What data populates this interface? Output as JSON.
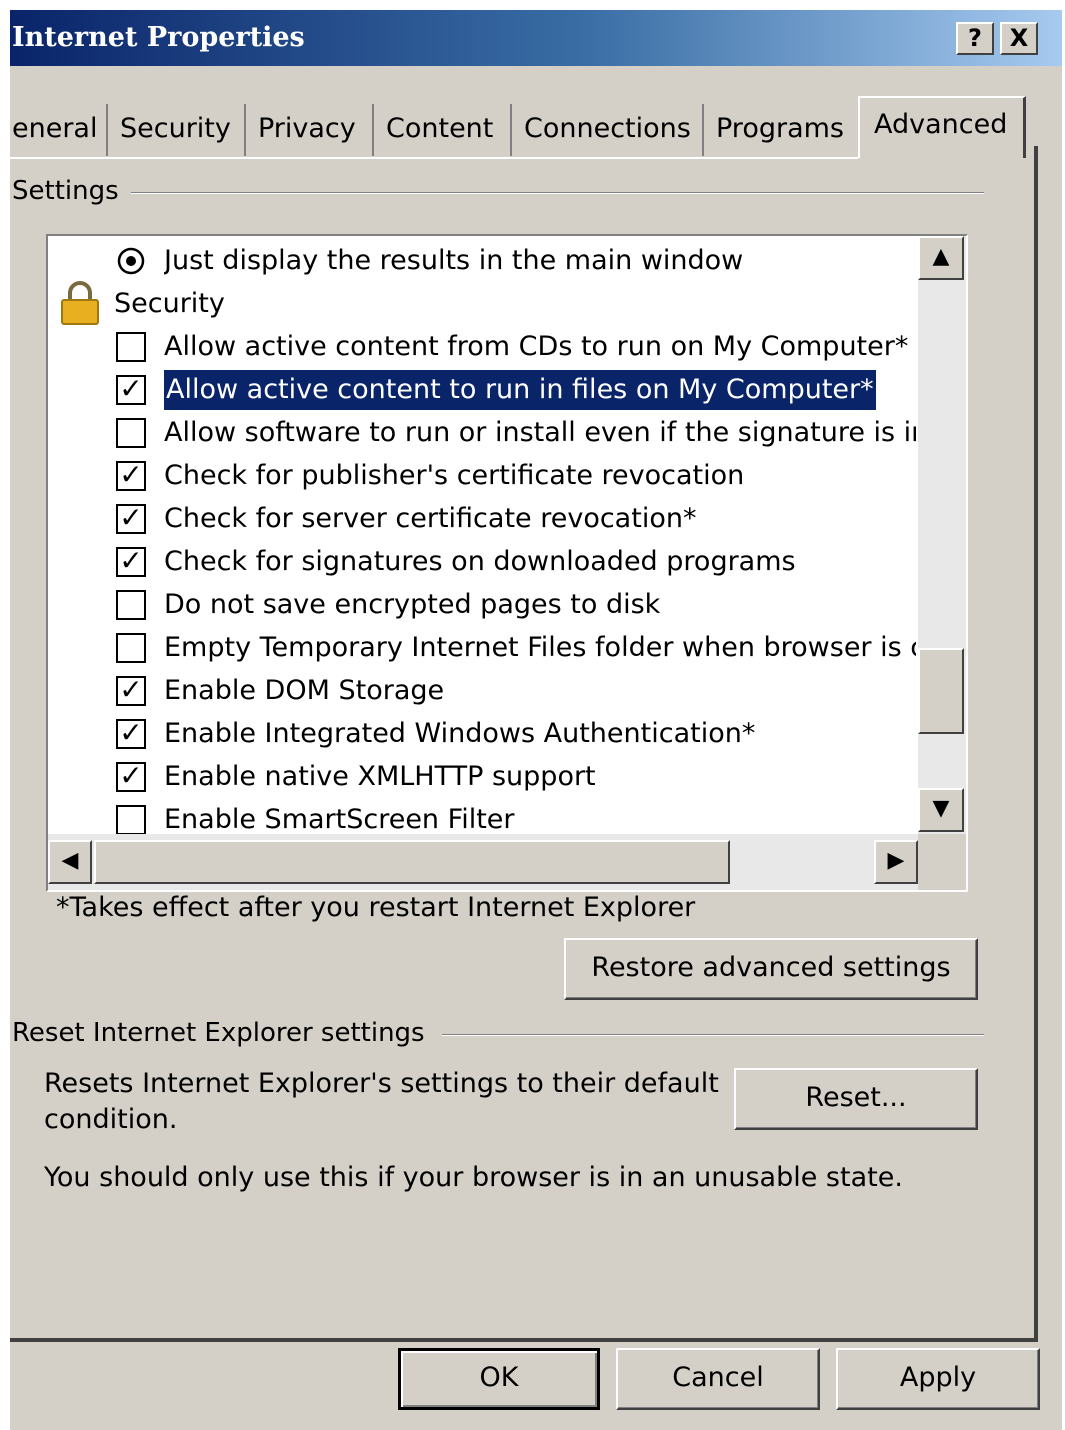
{
  "window": {
    "title": "Internet Properties",
    "help_button": "?",
    "close_button": "X"
  },
  "tabs": [
    {
      "label": "eneral"
    },
    {
      "label": "Security"
    },
    {
      "label": "Privacy"
    },
    {
      "label": "Content"
    },
    {
      "label": "Connections"
    },
    {
      "label": "Programs"
    },
    {
      "label": "Advanced",
      "active": true
    }
  ],
  "settings": {
    "group_label": "Settings",
    "items": [
      {
        "kind": "radio",
        "checked": true,
        "label": "Just display the results in the main window"
      },
      {
        "kind": "category",
        "icon": "lock-icon",
        "label": "Security"
      },
      {
        "kind": "checkbox",
        "checked": false,
        "label": "Allow active content from CDs to run on My Computer*"
      },
      {
        "kind": "checkbox",
        "checked": true,
        "selected": true,
        "label": "Allow active content to run in files on My Computer*"
      },
      {
        "kind": "checkbox",
        "checked": false,
        "label": "Allow software to run or install even if the signature is inva"
      },
      {
        "kind": "checkbox",
        "checked": true,
        "label": "Check for publisher's certificate revocation"
      },
      {
        "kind": "checkbox",
        "checked": true,
        "label": "Check for server certificate revocation*"
      },
      {
        "kind": "checkbox",
        "checked": true,
        "label": "Check for signatures on downloaded programs"
      },
      {
        "kind": "checkbox",
        "checked": false,
        "label": "Do not save encrypted pages to disk"
      },
      {
        "kind": "checkbox",
        "checked": false,
        "label": "Empty Temporary Internet Files folder when browser is clc"
      },
      {
        "kind": "checkbox",
        "checked": true,
        "label": "Enable DOM Storage"
      },
      {
        "kind": "checkbox",
        "checked": true,
        "label": "Enable Integrated Windows Authentication*"
      },
      {
        "kind": "checkbox",
        "checked": true,
        "label": "Enable native XMLHTTP support"
      },
      {
        "kind": "checkbox",
        "checked": false,
        "label": "Enable SmartScreen Filter"
      }
    ],
    "footnote": "*Takes effect after you restart Internet Explorer",
    "restore_button": "Restore advanced settings"
  },
  "reset": {
    "group_label": "Reset Internet Explorer settings",
    "description_line1": "Resets Internet Explorer's settings to their default",
    "description_line2": "condition.",
    "reset_button": "Reset...",
    "warning": "You should only use this if your browser is in an unusable state."
  },
  "footer": {
    "ok": "OK",
    "cancel": "Cancel",
    "apply": "Apply"
  },
  "colors": {
    "title_bar_start": "#0a246a",
    "title_bar_end": "#a6caf0",
    "selection": "#0a246a",
    "dialog_face": "#d4d0c8",
    "lock_icon": "#e8b020"
  }
}
